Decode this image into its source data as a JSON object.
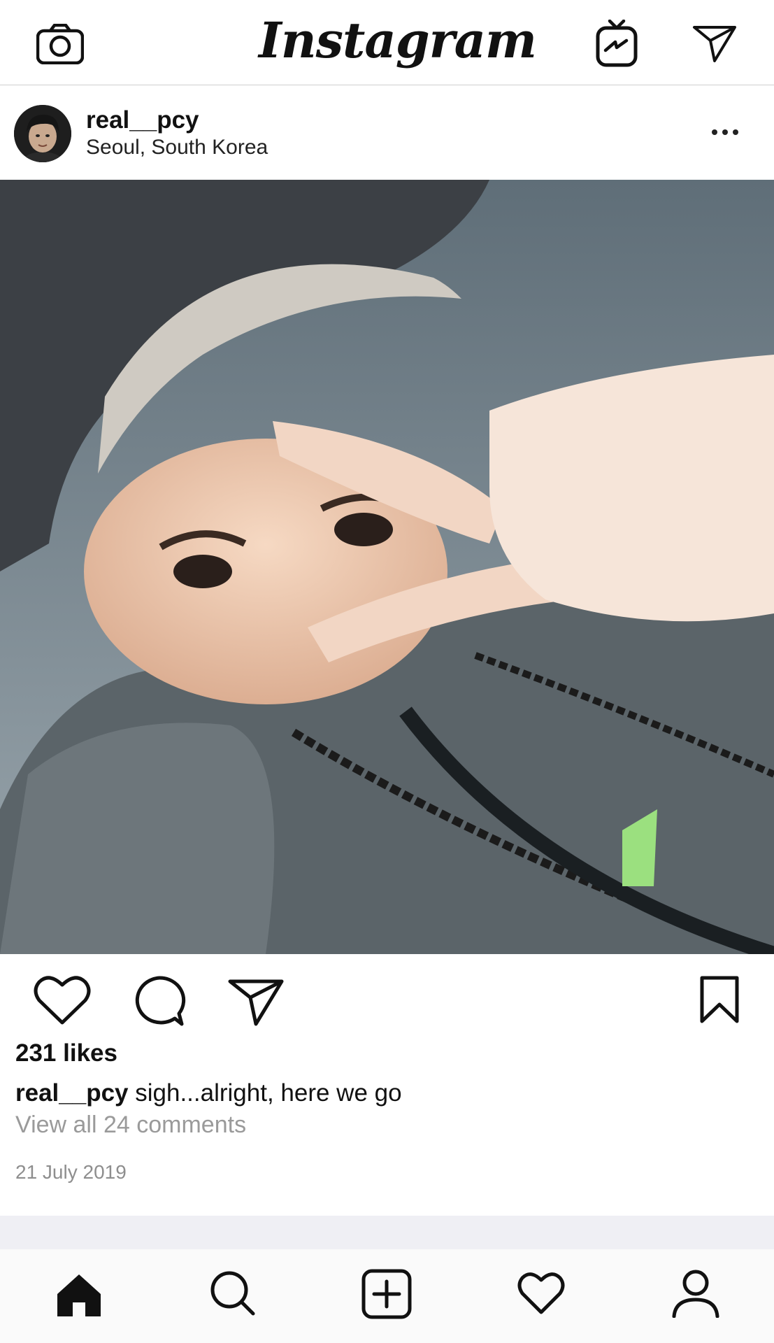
{
  "header": {
    "logo_text": "Instagram",
    "icons": [
      "camera-icon",
      "igtv-icon",
      "direct-message-icon"
    ]
  },
  "post": {
    "username": "real__pcy",
    "location": "Seoul, South Korea",
    "more_icon": "more-options-icon",
    "photo_description_icon": "post-photo",
    "actions": [
      "like-icon",
      "comment-icon",
      "share-icon",
      "bookmark-icon"
    ],
    "likes": "231 likes",
    "caption_user": "real__pcy",
    "caption_text": " sigh...alright, here we go",
    "view_comments": "View all 24 comments",
    "date": "21 July 2019"
  },
  "bottom_nav": [
    "home-icon",
    "search-icon",
    "new-post-icon",
    "activity-icon",
    "profile-icon"
  ],
  "colors": {
    "text": "#111111",
    "secondary_text": "#9a9a9a",
    "divider": "#cfcfcf",
    "band": "#efeff4"
  }
}
